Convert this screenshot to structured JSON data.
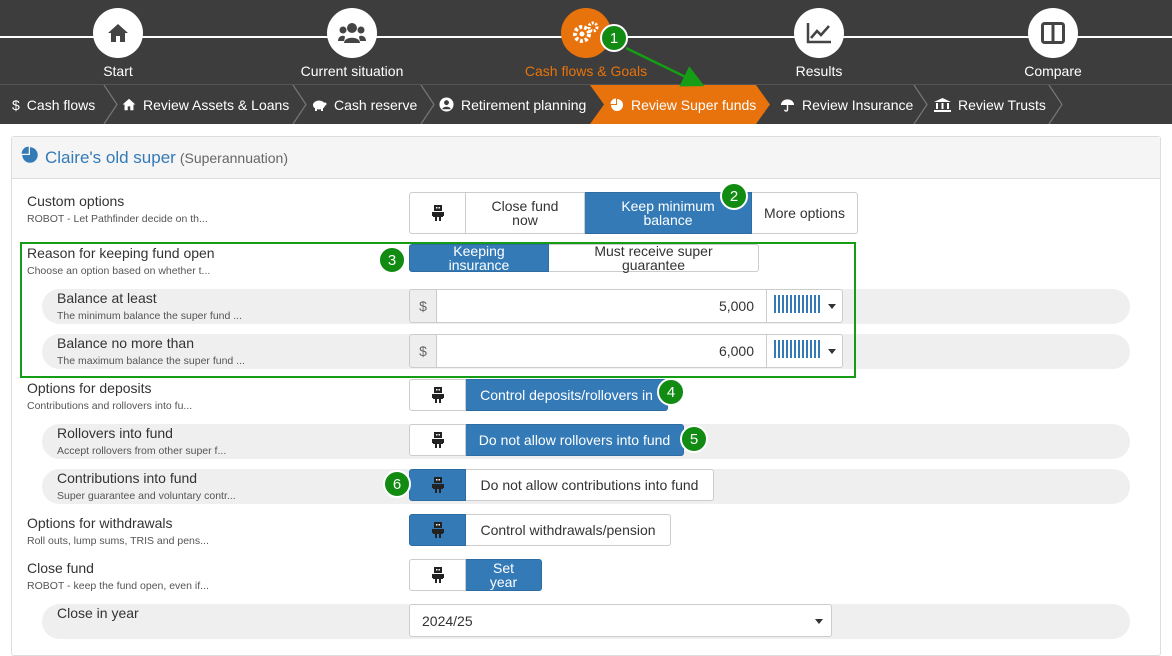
{
  "stepper": {
    "steps": [
      {
        "label": "Start",
        "icon": "home-icon"
      },
      {
        "label": "Current situation",
        "icon": "users-icon"
      },
      {
        "label": "Cash flows & Goals",
        "icon": "gears-icon",
        "active": true
      },
      {
        "label": "Results",
        "icon": "chart-line-icon"
      },
      {
        "label": "Compare",
        "icon": "columns-icon"
      }
    ]
  },
  "tabs": [
    {
      "label": "Cash flows",
      "icon": "dollar-icon"
    },
    {
      "label": "Review Assets & Loans",
      "icon": "home-icon"
    },
    {
      "label": "Cash reserve",
      "icon": "piggy-bank-icon"
    },
    {
      "label": "Retirement planning",
      "icon": "user-circle-icon"
    },
    {
      "label": "Review Super funds",
      "icon": "pie-chart-icon",
      "active": true
    },
    {
      "label": "Review Insurance",
      "icon": "umbrella-icon"
    },
    {
      "label": "Review Trusts",
      "icon": "bank-icon"
    }
  ],
  "panel": {
    "title": "Claire's old super",
    "subtitle": "(Superannuation)"
  },
  "custom": {
    "label": "Custom options",
    "desc": "ROBOT - Let Pathfinder decide on th...",
    "b1": "Close fund now",
    "b2": "Keep minimum balance",
    "b3": "More options"
  },
  "reason": {
    "label": "Reason for keeping fund open",
    "desc": "Choose an option based on whether t...",
    "b1": "Keeping insurance",
    "b2": "Must receive super guarantee"
  },
  "atleast": {
    "label": "Balance at least",
    "desc": "The minimum balance the super fund ...",
    "currency": "$",
    "value": "5,000"
  },
  "nomore": {
    "label": "Balance no more than",
    "desc": "The maximum balance the super fund ...",
    "currency": "$",
    "value": "6,000"
  },
  "deposits": {
    "label": "Options for deposits",
    "desc": "Contributions and rollovers into fu...",
    "b1": "Control deposits/rollovers in"
  },
  "rollovers": {
    "label": "Rollovers into fund",
    "desc": "Accept rollovers from other super f...",
    "b1": "Do not allow rollovers into fund"
  },
  "contrib": {
    "label": "Contributions into fund",
    "desc": "Super guarantee and voluntary contr...",
    "b1": "Do not allow contributions into fund"
  },
  "withdraw": {
    "label": "Options for withdrawals",
    "desc": "Roll outs, lump sums, TRIS and pens...",
    "b1": "Control withdrawals/pension"
  },
  "closefund": {
    "label": "Close fund",
    "desc": "ROBOT - keep the fund open, even if...",
    "b1": "Set year"
  },
  "closeyear": {
    "label": "Close in year",
    "value": "2024/25"
  },
  "badges": [
    "1",
    "2",
    "3",
    "4",
    "5",
    "6"
  ],
  "colors": {
    "accent": "#e8730c",
    "primary": "#337ab7",
    "annotation": "#118b11",
    "bar": "#3d3d3d"
  }
}
